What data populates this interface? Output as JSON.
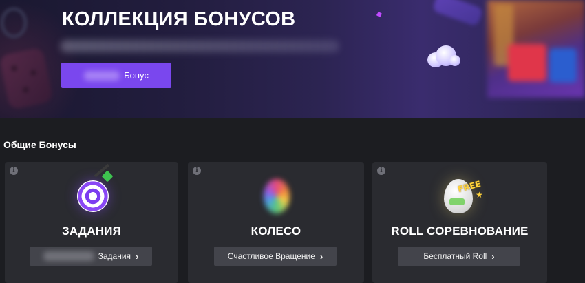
{
  "hero": {
    "title": "КОЛЛЕКЦИЯ БОНУСОВ",
    "button_label": "Бонус"
  },
  "section": {
    "title": "Общие Бонусы"
  },
  "cards": [
    {
      "title": "ЗАДАНИЯ",
      "button_label": "Задания",
      "icon": "target-dart-icon"
    },
    {
      "title": "КОЛЕСО",
      "button_label": "Счастливое Вращение",
      "icon": "fortune-wheel-icon"
    },
    {
      "title": "ROLL СОРЕВНОВАНИЕ",
      "button_label": "Бесплатный Roll",
      "icon": "free-egg-icon",
      "badge": "FREE"
    }
  ],
  "colors": {
    "accent": "#7a47ee",
    "card_bg": "#2a2b30",
    "page_bg": "#1c1d21",
    "button_bg": "#43444b"
  }
}
